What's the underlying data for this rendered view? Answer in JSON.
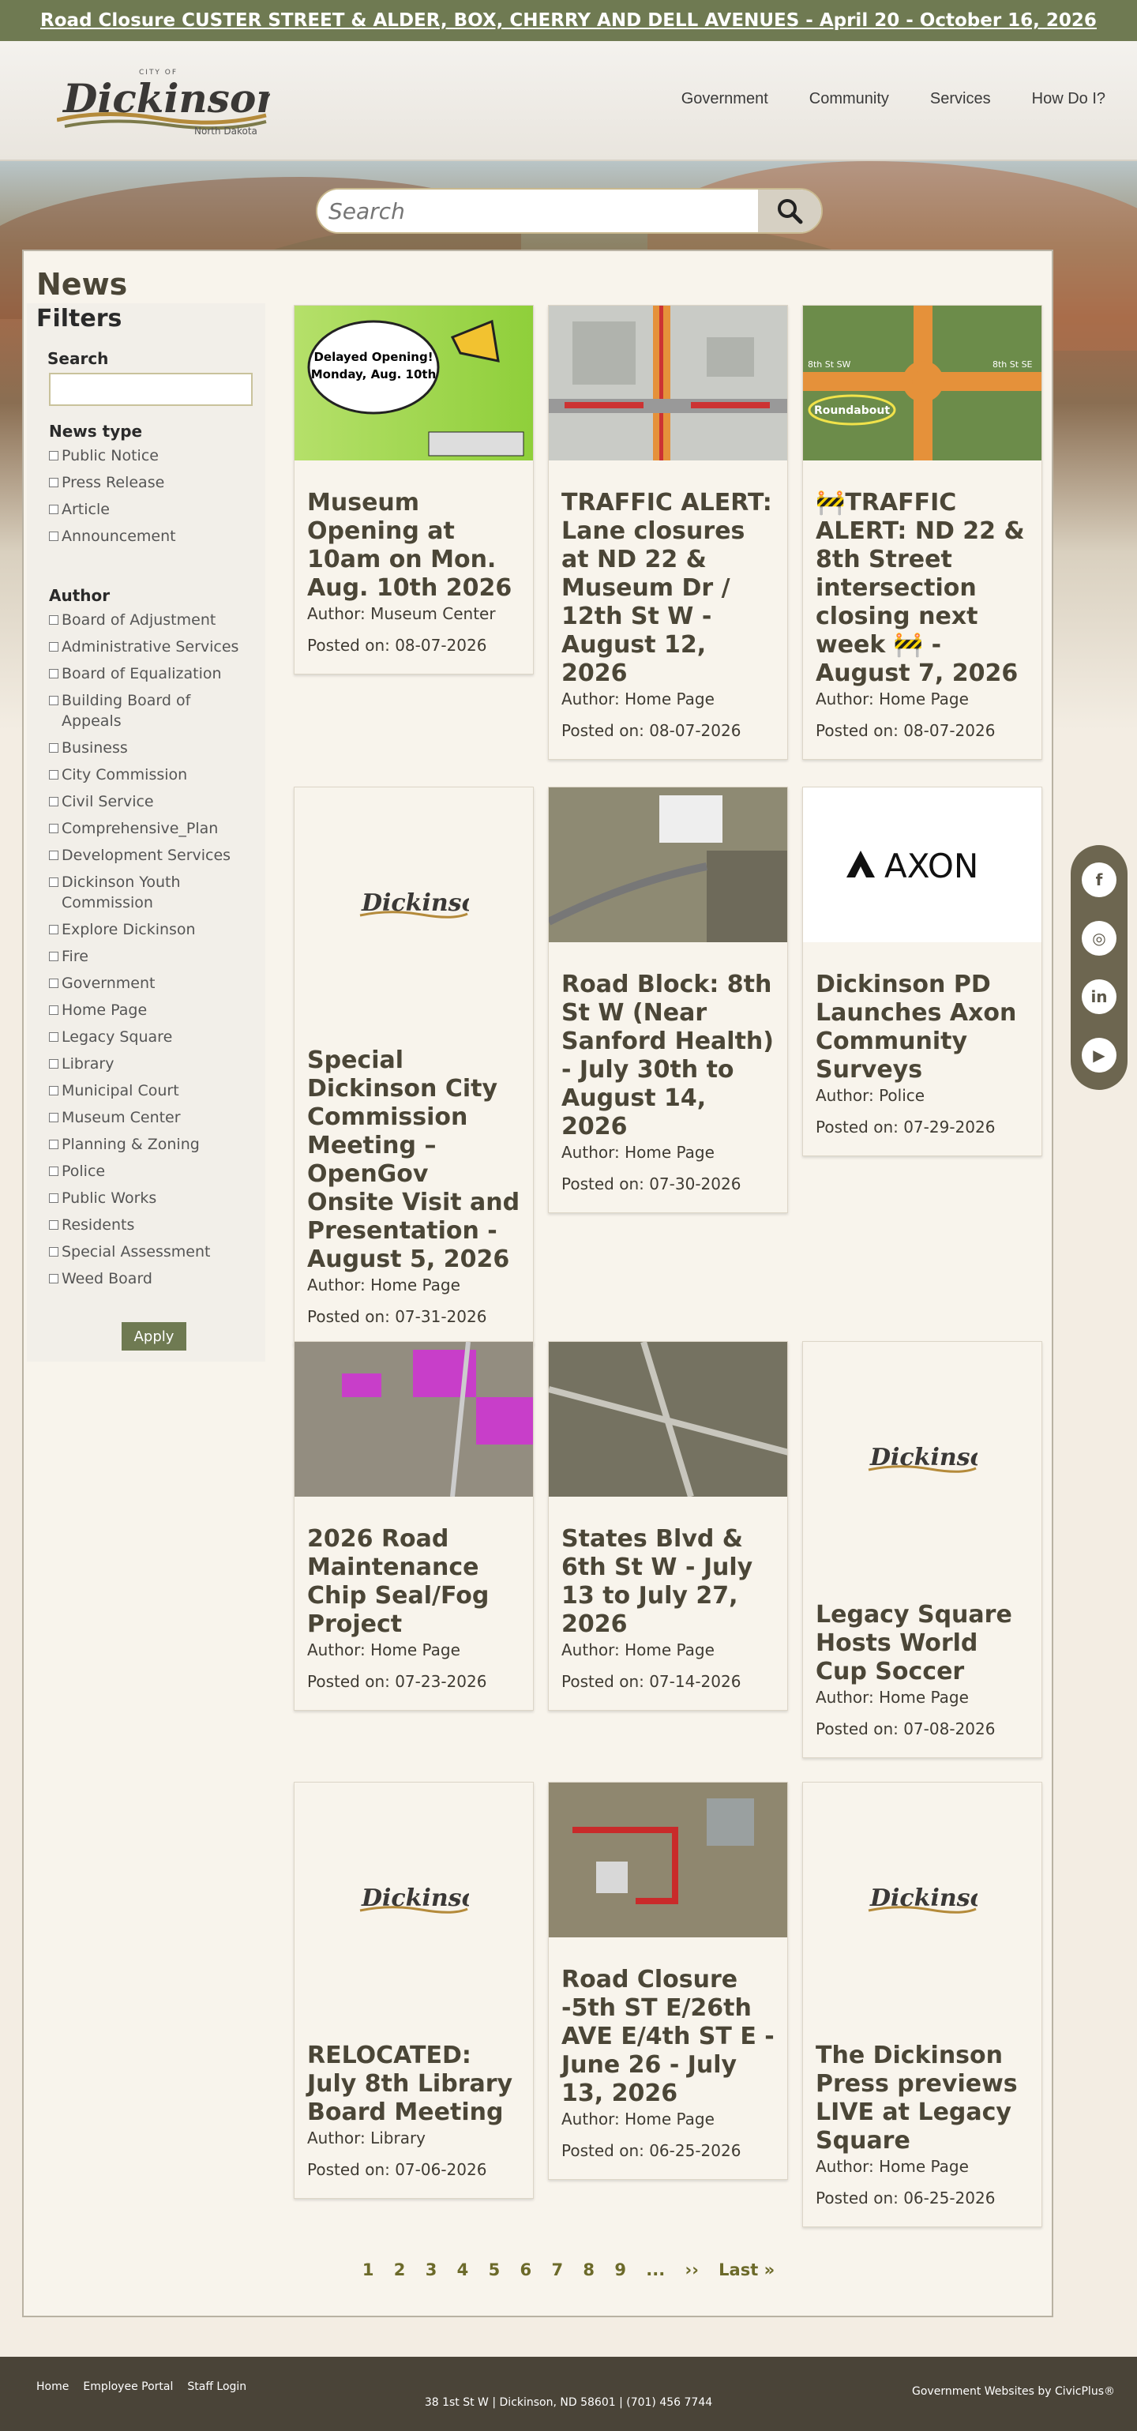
{
  "alert": {
    "text": "Road Closure CUSTER STREET & ALDER, BOX, CHERRY AND DELL AVENUES - April 20 - October 16, 2026"
  },
  "logo": {
    "city_of": "CITY OF",
    "name": "Dickinson",
    "state": "North Dakota"
  },
  "nav": {
    "items": [
      "Government",
      "Community",
      "Services",
      "How Do I?"
    ]
  },
  "search": {
    "placeholder": "Search"
  },
  "page": {
    "title": "News"
  },
  "filters": {
    "heading": "Filters",
    "search_label": "Search",
    "news_type_label": "News type",
    "news_types": [
      "Public Notice",
      "Press Release",
      "Article",
      "Announcement"
    ],
    "author_label": "Author",
    "authors": [
      "Board of Adjustment",
      "Administrative Services",
      "Board of Equalization",
      "Building Board of Appeals",
      "Business",
      "City Commission",
      "Civil Service",
      "Comprehensive_Plan",
      "Development Services",
      "Dickinson Youth Commission",
      "Explore Dickinson",
      "Fire",
      "Government",
      "Home Page",
      "Legacy Square",
      "Library",
      "Municipal Court",
      "Museum Center",
      "Planning & Zoning",
      "Police",
      "Public Works",
      "Residents",
      "Special Assessment",
      "Weed Board"
    ],
    "apply_label": "Apply"
  },
  "card_images": {
    "museum_bubble_line1": "Delayed Opening!",
    "museum_bubble_line2": "Monday, Aug. 10th",
    "roundabout_label": "Roundabout",
    "street_8th_sw": "8th St SW",
    "street_8th_se": "8th St SE",
    "axon_text": "AXON"
  },
  "cards": [
    {
      "title": "Museum Opening at 10am on Mon. Aug. 10th 2026",
      "author": "Author: Museum Center",
      "date": "Posted on: 08-07-2026"
    },
    {
      "title": "TRAFFIC ALERT: Lane closures at ND 22 & Museum Dr / 12th St W - August 12, 2026",
      "author": "Author: Home Page",
      "date": "Posted on: 08-07-2026"
    },
    {
      "title": "🚧TRAFFIC ALERT: ND 22 & 8th Street intersection closing next week 🚧 - August 7, 2026",
      "author": "Author: Home Page",
      "date": "Posted on: 08-07-2026"
    },
    {
      "title": "Special Dickinson City Commission Meeting – OpenGov Onsite Visit and Presentation - August 5, 2026",
      "author": "Author: Home Page",
      "date": "Posted on: 07-31-2026"
    },
    {
      "title": "Road Block: 8th St W (Near Sanford Health) - July 30th to August 14, 2026",
      "author": "Author: Home Page",
      "date": "Posted on: 07-30-2026"
    },
    {
      "title": "Dickinson PD Launches Axon Community Surveys",
      "author": "Author: Police",
      "date": "Posted on: 07-29-2026"
    },
    {
      "title": "2026 Road Maintenance Chip Seal/Fog Project",
      "author": "Author: Home Page",
      "date": "Posted on: 07-23-2026"
    },
    {
      "title": "States Blvd & 6th St W - July 13 to July 27, 2026",
      "author": "Author: Home Page",
      "date": "Posted on: 07-14-2026"
    },
    {
      "title": "Legacy Square Hosts World Cup Soccer",
      "author": "Author: Home Page",
      "date": "Posted on: 07-08-2026"
    },
    {
      "title": "RELOCATED: July 8th Library Board Meeting",
      "author": "Author: Library",
      "date": "Posted on: 07-06-2026"
    },
    {
      "title": "Road Closure -5th ST E/26th AVE E/4th ST E - June 26 - July 13, 2026",
      "author": "Author: Home Page",
      "date": "Posted on: 06-25-2026"
    },
    {
      "title": "The Dickinson Press previews LIVE at Legacy Square",
      "author": "Author: Home Page",
      "date": "Posted on: 06-25-2026"
    }
  ],
  "pagination": {
    "pages": [
      "1",
      "2",
      "3",
      "4",
      "5",
      "6",
      "7",
      "8",
      "9"
    ],
    "ellipsis": "...",
    "next": "››",
    "last": "Last »"
  },
  "social": {
    "icons": [
      "facebook-icon",
      "instagram-icon",
      "linkedin-icon",
      "youtube-icon"
    ],
    "glyphs": [
      "f",
      "◎",
      "in",
      "▶"
    ]
  },
  "footer": {
    "links": [
      "Home",
      "Employee Portal",
      "Staff Login"
    ],
    "address": "38 1st St W | Dickinson, ND 58601 | (701) 456 7744",
    "credit": "Government Websites by CivicPlus®"
  }
}
